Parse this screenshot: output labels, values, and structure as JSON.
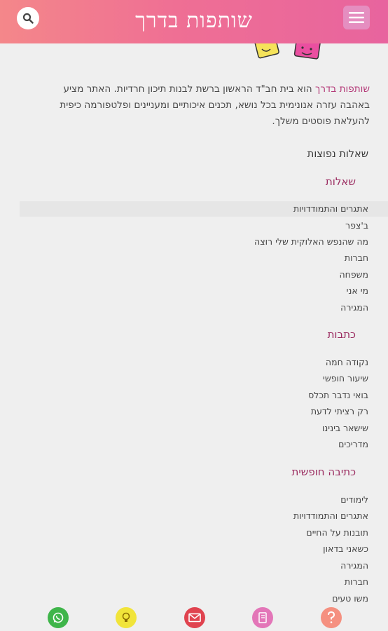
{
  "header": {
    "logo_text": "שותפות בדרך",
    "search_icon": "search-icon",
    "menu_icon": "hamburger-menu-icon",
    "gradient_start": "#f4878a",
    "gradient_end": "#e8649e"
  },
  "intro": {
    "brand": "שותפות בדרך",
    "text": " הוא בית חב\"ד הראשון ברשת לבנות תיכון חרדיות. האתר מציע באהבה עזרה אנונימית בכל נושא, תכנים איכותיים ומעניינים ופלטפורמה כיפית להעלאת פוסטים משלך."
  },
  "faq_heading": "שאלות נפוצות",
  "sections": [
    {
      "title": "שאלות",
      "items": [
        "אתגרים והתמודדויות",
        "ב'צפר",
        "מה שהנפש האלוקית שלי רוצה",
        "חברות",
        "משפחה",
        "מי אני",
        "המגירה"
      ]
    },
    {
      "title": "כתבות",
      "items": [
        "נקודה חמה",
        "שיעור חופשי",
        "בואי נדבר תכלס",
        "רק רציתי לדעת",
        "שישאר בינינו",
        "מדריכים"
      ]
    },
    {
      "title": "כתיבה חופשית",
      "items": [
        "לימודים",
        "אתגרים והתמודדויות",
        "תובנות על החיים",
        "כשאני בדאון",
        "המגירה",
        "חברות",
        "משו טעים"
      ]
    }
  ],
  "bottom_bar": {
    "icons": [
      {
        "name": "whatsapp-icon",
        "color": "#3fb54a"
      },
      {
        "name": "lightbulb-icon",
        "color": "#f1e43a"
      },
      {
        "name": "mail-icon",
        "color": "#e0434f"
      },
      {
        "name": "notebook-icon",
        "color": "#e376b8"
      },
      {
        "name": "question-icon",
        "color": "#f59080"
      }
    ]
  }
}
